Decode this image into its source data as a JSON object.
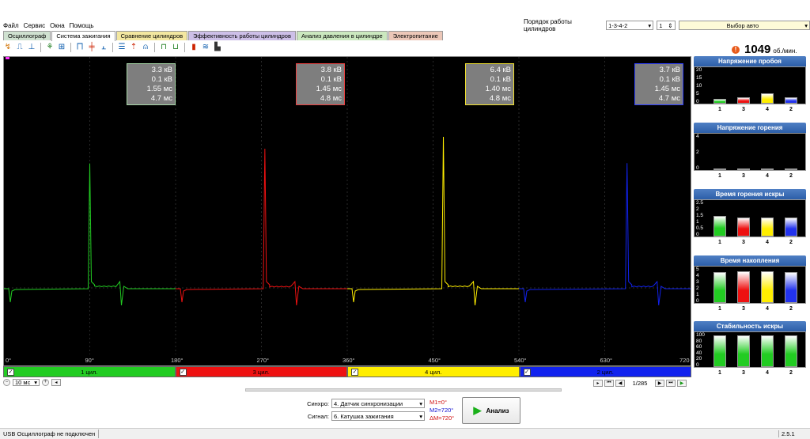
{
  "menu": [
    "Файл",
    "Сервис",
    "Окна",
    "Помощь"
  ],
  "tabs": [
    {
      "label": "Осциллограф",
      "color": "#cfe1d0"
    },
    {
      "label": "Система зажигания",
      "color": "#ffffff",
      "active": true
    },
    {
      "label": "Сравнение цилиндров",
      "color": "#f3e7a0"
    },
    {
      "label": "Эффективность работы цилиндров",
      "color": "#cdbfe8"
    },
    {
      "label": "Анализ давления в цилиндре",
      "color": "#cbe8bf"
    },
    {
      "label": "Электропитание",
      "color": "#ecc7b8"
    }
  ],
  "top_controls": {
    "order_label": "Порядок работы цилиндров",
    "order_value": "1-3-4-2",
    "spin_value": "1",
    "mode_value": "Выбор авто"
  },
  "rpm": {
    "value": "1049",
    "unit": "об./мин."
  },
  "info_boxes": [
    {
      "lines": [
        "3.3 кВ",
        "0.1 кВ",
        "1.55 мс",
        "4.7 мс"
      ],
      "border": "#a8d8a8"
    },
    {
      "lines": [
        "3.8 кВ",
        "0.1 кВ",
        "1.45 мс",
        "4.8 мс"
      ],
      "border": "#e84040"
    },
    {
      "lines": [
        "6.4 кВ",
        "0.1 кВ",
        "1.40 мс",
        "4.8 мс"
      ],
      "border": "#f0e030"
    },
    {
      "lines": [
        "3.7 кВ",
        "0.1 кВ",
        "1.45 мс",
        "4.7 мс"
      ],
      "border": "#3040ff"
    }
  ],
  "angle_ticks": [
    "0°",
    "90°",
    "180°",
    "270°",
    "360°",
    "450°",
    "540°",
    "630°",
    "720"
  ],
  "cylinders": [
    {
      "label": "1 цил.",
      "color": "#22cc22"
    },
    {
      "label": "3 цил.",
      "color": "#ee1111"
    },
    {
      "label": "4 цил.",
      "color": "#ffee00"
    },
    {
      "label": "2 цил.",
      "color": "#1122ee"
    }
  ],
  "timebase": "10 мс",
  "nav": {
    "counter": "1/285"
  },
  "synchro": {
    "sync_label": "Синхро:",
    "sync_value": "4. Датчик синхронизации",
    "signal_label": "Сигнал:",
    "signal_value": "6. Катушка зажигания"
  },
  "markers": {
    "m1": "M1=0°",
    "m2": "M2=720°",
    "dm": "ΔM=720°"
  },
  "analyze_label": "Анализ",
  "status": {
    "left": "USB Осциллограф не подключен",
    "version": "2.5.1"
  },
  "chart_data": [
    {
      "type": "bar",
      "title": "Напряжение пробоя",
      "categories": [
        "1",
        "3",
        "4",
        "2"
      ],
      "values": [
        2.7,
        3.8,
        6.4,
        3.7
      ],
      "colors": [
        "#22cc22",
        "#ee1111",
        "#ffee00",
        "#2233ee"
      ],
      "yticks": [
        "20",
        "15",
        "10",
        "5",
        "0"
      ],
      "ylim": [
        0,
        20
      ]
    },
    {
      "type": "bar",
      "title": "Напряжение горения",
      "categories": [
        "1",
        "3",
        "4",
        "2"
      ],
      "values": [
        0.1,
        0.1,
        0.1,
        0.1
      ],
      "colors": [
        "#888888",
        "#888888",
        "#888888",
        "#888888"
      ],
      "yticks": [
        "4",
        "2",
        "0"
      ],
      "ylim": [
        0,
        6
      ]
    },
    {
      "type": "bar",
      "title": "Время горения искры",
      "categories": [
        "1",
        "3",
        "4",
        "2"
      ],
      "values": [
        1.55,
        1.45,
        1.4,
        1.45
      ],
      "colors": [
        "#22cc22",
        "#ee1111",
        "#ffee00",
        "#2233ee"
      ],
      "yticks": [
        "2.5",
        "2",
        "1.5",
        "1",
        "0.5",
        "0"
      ],
      "ylim": [
        0,
        2.5
      ]
    },
    {
      "type": "bar",
      "title": "Время накопления",
      "categories": [
        "1",
        "3",
        "4",
        "2"
      ],
      "values": [
        4.7,
        4.8,
        4.8,
        4.7
      ],
      "colors": [
        "#22cc22",
        "#ee1111",
        "#ffee00",
        "#2233ee"
      ],
      "yticks": [
        "5",
        "4",
        "3",
        "2",
        "1",
        "0"
      ],
      "ylim": [
        0,
        5
      ]
    },
    {
      "type": "bar",
      "title": "Стабильность искры",
      "categories": [
        "1",
        "3",
        "4",
        "2"
      ],
      "values": [
        100,
        100,
        100,
        100
      ],
      "colors": [
        "#22cc22",
        "#22cc22",
        "#22cc22",
        "#22cc22"
      ],
      "yticks": [
        "100",
        "80",
        "60",
        "40",
        "20",
        "0"
      ],
      "ylim": [
        0,
        100
      ]
    }
  ]
}
